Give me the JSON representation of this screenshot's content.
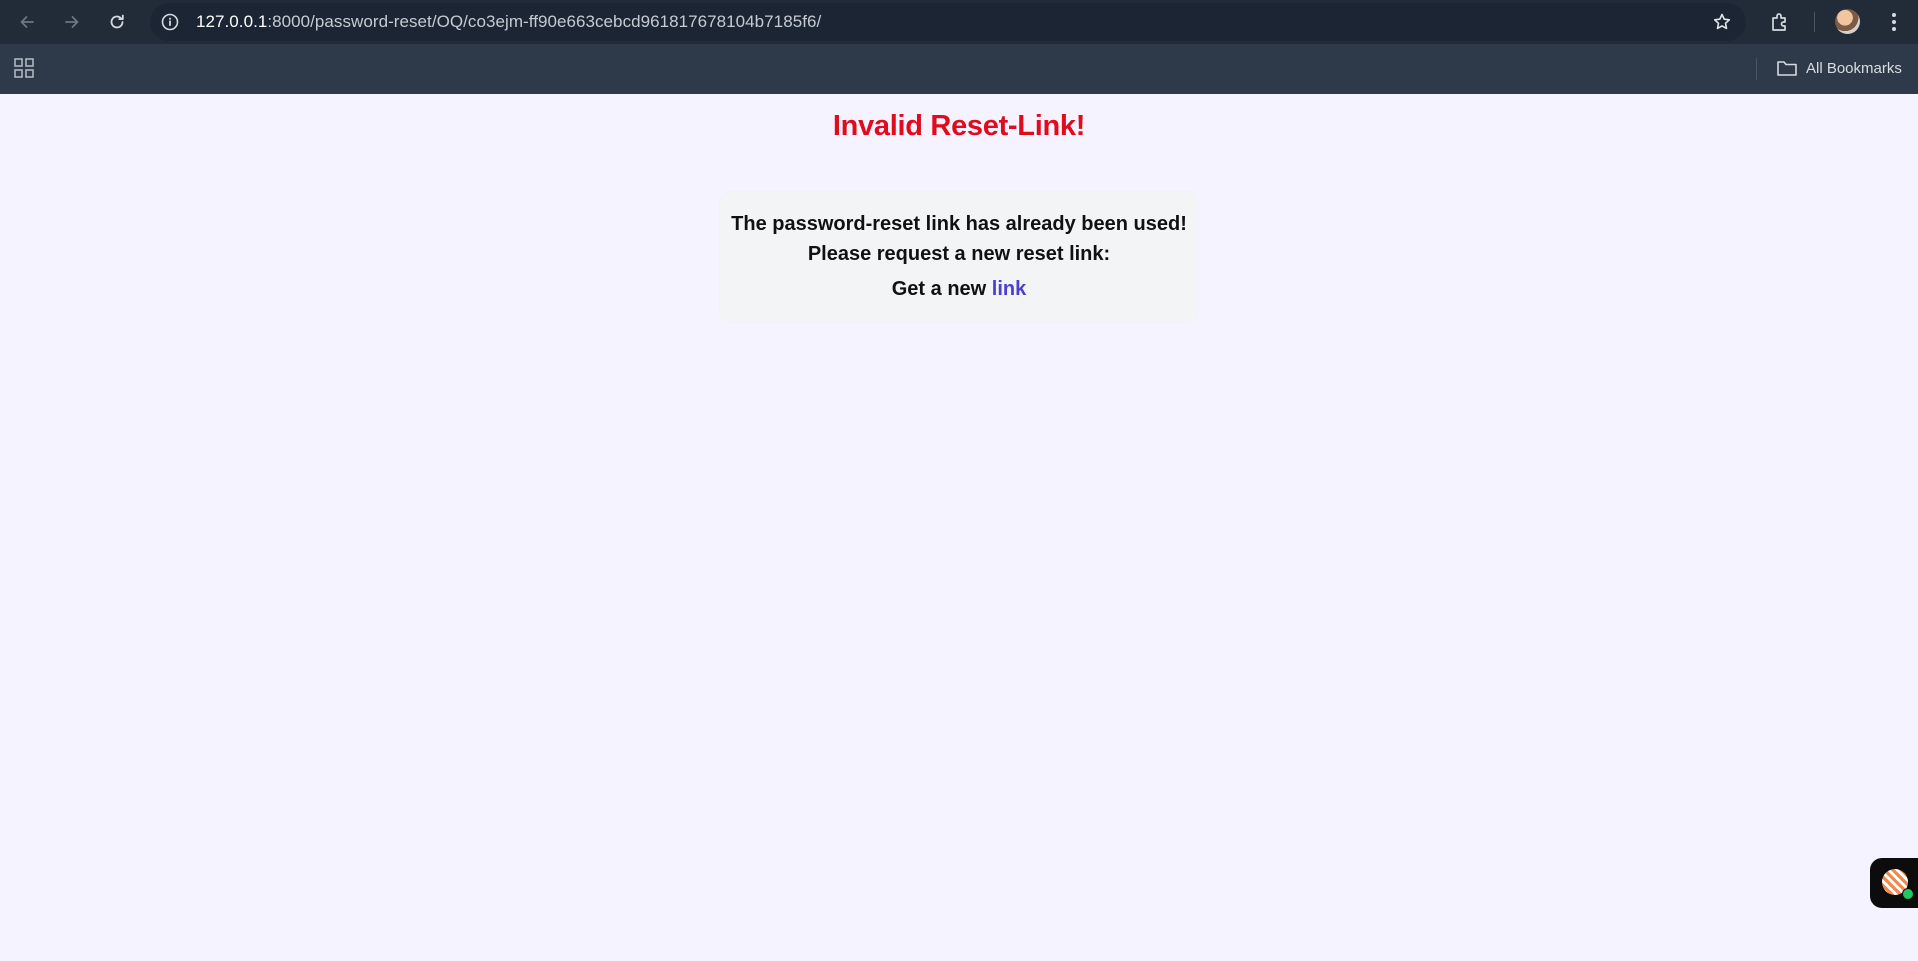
{
  "browser": {
    "url_host": "127.0.0.1",
    "url_rest": ":8000/password-reset/OQ/co3ejm-ff90e663cebcd961817678104b7185f6/",
    "bookmarks_label": "All Bookmarks",
    "icons": [
      "back-icon",
      "forward-icon",
      "reload-icon",
      "info-icon",
      "star-icon",
      "extensions-icon",
      "profile-avatar",
      "more-icon",
      "apps-icon",
      "folder-icon"
    ]
  },
  "page": {
    "title": "Invalid Reset-Link!",
    "message_line1": "The password-reset link has already been used!",
    "message_line2": "Please request a new reset link:",
    "get_new_prefix": "Get a new ",
    "link_label": "link"
  },
  "colors": {
    "title": "#e00b1c",
    "link": "#4b3ed6",
    "page_background": "#f5f3ff",
    "card_background": "#f3f4f6"
  }
}
